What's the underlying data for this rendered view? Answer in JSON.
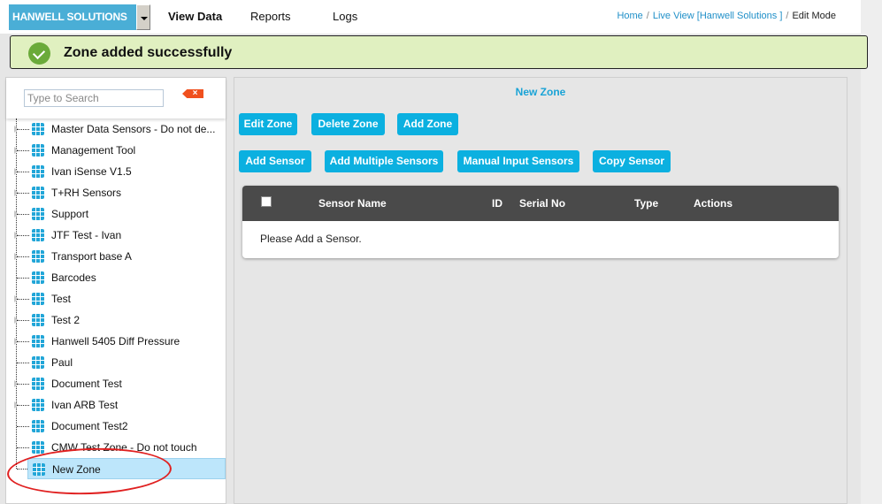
{
  "header": {
    "brand": "HANWELL SOLUTIONS",
    "nav": [
      {
        "label": "View Data",
        "active": true
      },
      {
        "label": "Reports",
        "active": false
      },
      {
        "label": "Logs",
        "active": false
      }
    ],
    "breadcrumb": [
      {
        "label": "Home",
        "link": true
      },
      {
        "label": "Live View [Hanwell Solutions ]",
        "link": true
      },
      {
        "label": "Edit Mode",
        "link": false
      }
    ]
  },
  "alert": {
    "type": "success",
    "icon": "check-circle-icon",
    "message": "Zone added successfully",
    "color": "#6aaa3a"
  },
  "sidebar": {
    "search": {
      "placeholder": "Type to Search",
      "value": "",
      "clear_label": "×"
    },
    "items": [
      {
        "label": "Master Data Sensors - Do not de...",
        "expandable": true
      },
      {
        "label": "Management Tool",
        "expandable": true
      },
      {
        "label": "Ivan iSense V1.5",
        "expandable": true
      },
      {
        "label": "T+RH Sensors",
        "expandable": true
      },
      {
        "label": "Support",
        "expandable": true
      },
      {
        "label": "JTF Test - Ivan",
        "expandable": true
      },
      {
        "label": "Transport base A",
        "expandable": true
      },
      {
        "label": "Barcodes",
        "expandable": false
      },
      {
        "label": "Test",
        "expandable": true
      },
      {
        "label": "Test 2",
        "expandable": true
      },
      {
        "label": "Hanwell 5405 Diff Pressure",
        "expandable": true
      },
      {
        "label": "Paul",
        "expandable": false
      },
      {
        "label": "Document Test",
        "expandable": true
      },
      {
        "label": "Ivan ARB Test",
        "expandable": true
      },
      {
        "label": "Document Test2",
        "expandable": false
      },
      {
        "label": "CMW Test Zone - Do not touch",
        "expandable": false
      },
      {
        "label": "New Zone",
        "expandable": false,
        "selected": true
      }
    ]
  },
  "main": {
    "zone_title": "New Zone",
    "zone_buttons": [
      "Edit Zone",
      "Delete Zone",
      "Add Zone"
    ],
    "sensor_buttons": [
      "Add Sensor",
      "Add Multiple Sensors",
      "Manual Input Sensors",
      "Copy Sensor"
    ],
    "table": {
      "columns": [
        "Sensor Name",
        "ID",
        "Serial No",
        "Type",
        "Actions"
      ],
      "rows": [],
      "empty_message": "Please Add a Sensor."
    },
    "accent_color": "#0bb0e0"
  }
}
